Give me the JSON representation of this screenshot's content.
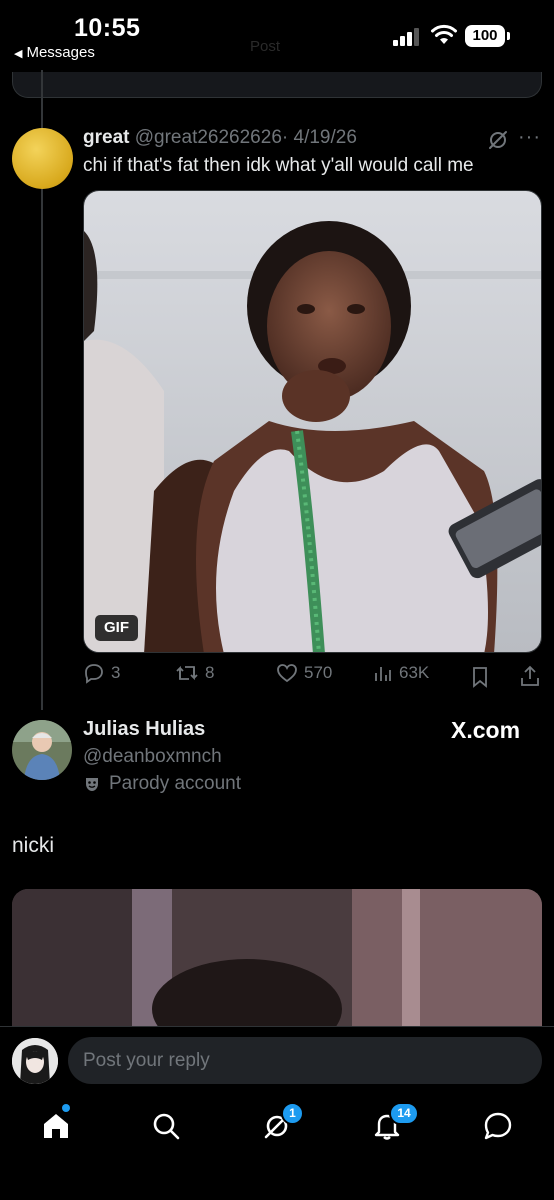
{
  "status_bar": {
    "time": "10:55",
    "back_label": "Messages",
    "battery": "100"
  },
  "header": {
    "title_faint": "Post"
  },
  "quoted_tweet": {
    "author_name": "great",
    "author_handle": "@great26262626",
    "date": "· 4/19/26",
    "text": "chi if that's fat then idk what y'all would call me",
    "media_badge": "GIF",
    "replies": "3",
    "reposts": "8",
    "likes": "570",
    "views": "63K"
  },
  "reply": {
    "author_name": "Julias Hulias",
    "author_handle": "@deanboxmnch",
    "parody_label": "Parody account",
    "text": "nicki",
    "source_badge": "X.com"
  },
  "composer": {
    "placeholder": "Post your reply"
  },
  "bottom_nav": {
    "items": [
      "home-icon",
      "search-icon",
      "grok-icon",
      "notifications-icon",
      "messages-icon"
    ],
    "grok_badge": "1",
    "notifications_badge": "14"
  },
  "colors": {
    "accent": "#1d9bf0",
    "muted": "#71767b",
    "text": "#e7e9ea",
    "background": "#000000"
  }
}
